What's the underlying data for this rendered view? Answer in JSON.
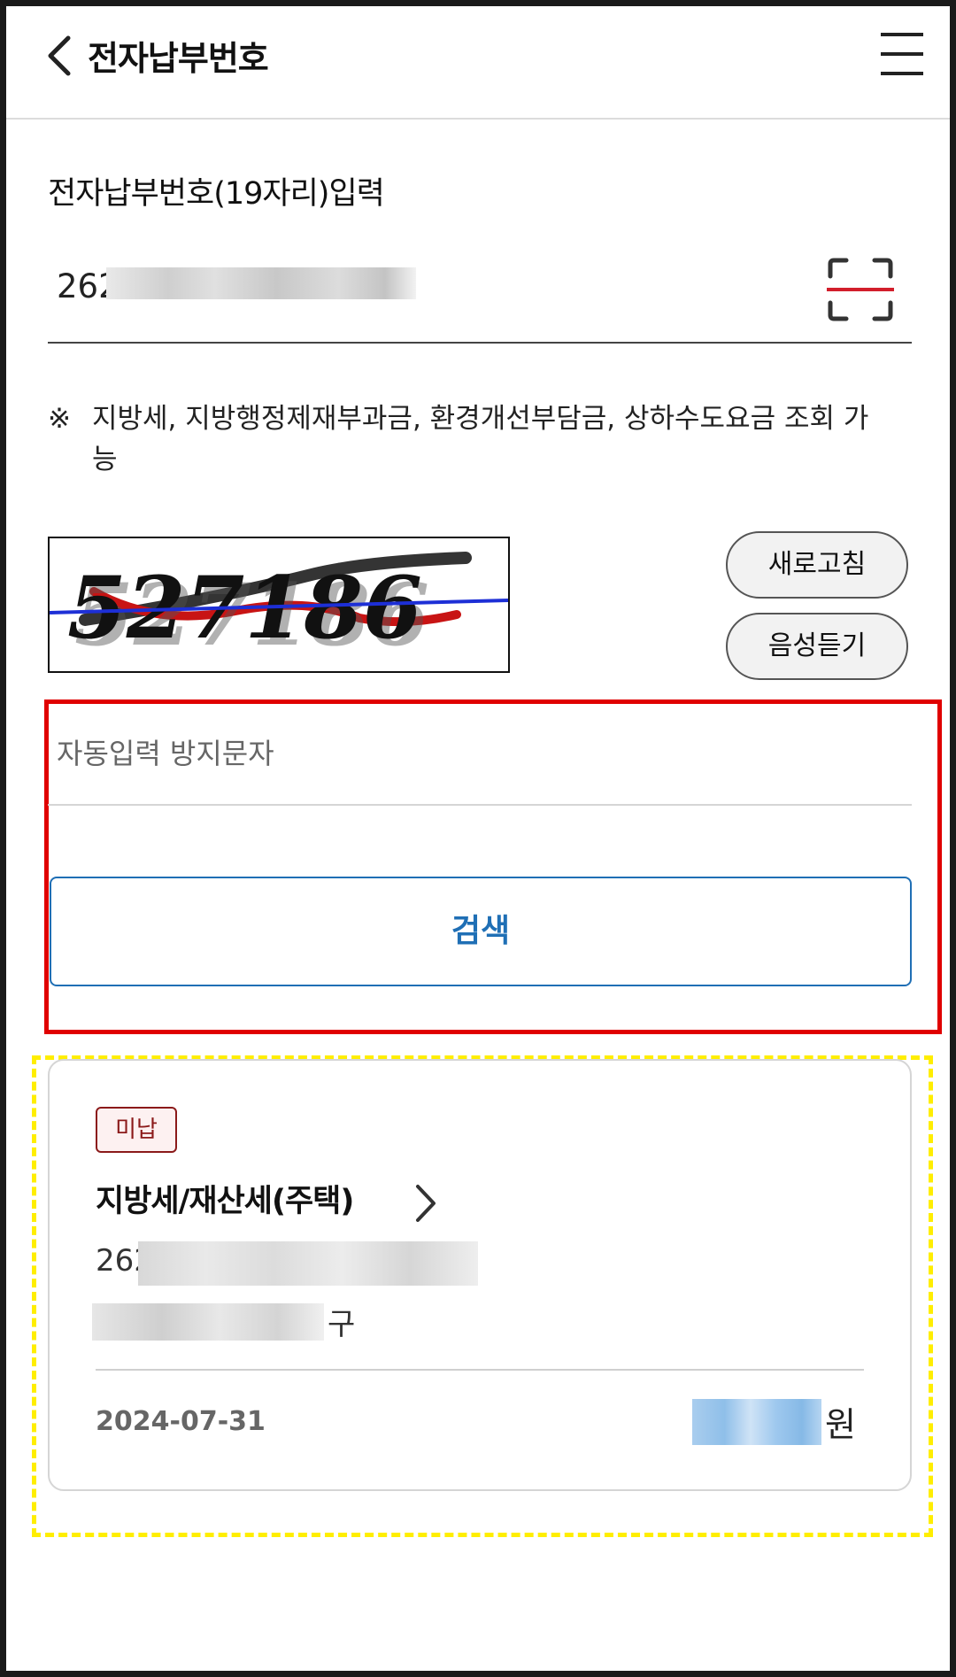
{
  "header": {
    "title": "전자납부번호",
    "back_icon": "chevron-left-icon",
    "menu_icon": "hamburger-menu-icon"
  },
  "input_section": {
    "label": "전자납부번호(19자리)입력",
    "number_prefix": "262",
    "scan_icon": "barcode-scan-icon",
    "note_mark": "※",
    "note": "지방세, 지방행정제재부과금, 환경개선부담금, 상하수도요금 조회 가능"
  },
  "captcha": {
    "text": "527186",
    "refresh_label": "새로고침",
    "voice_label": "음성듣기"
  },
  "auto_input": {
    "placeholder": "자동입력 방지문자"
  },
  "search": {
    "label": "검색"
  },
  "result_card": {
    "badge": "미납",
    "title": "지방세/재산세(주택)",
    "account_prefix": "262",
    "region_suffix": "구",
    "date": "2024-07-31",
    "amount_unit": "원",
    "colors": {
      "badge_border": "#8b1a1a",
      "accent_blue": "#1f6fb5",
      "highlight_red": "#e00000",
      "highlight_yellow": "#ffee00"
    }
  }
}
